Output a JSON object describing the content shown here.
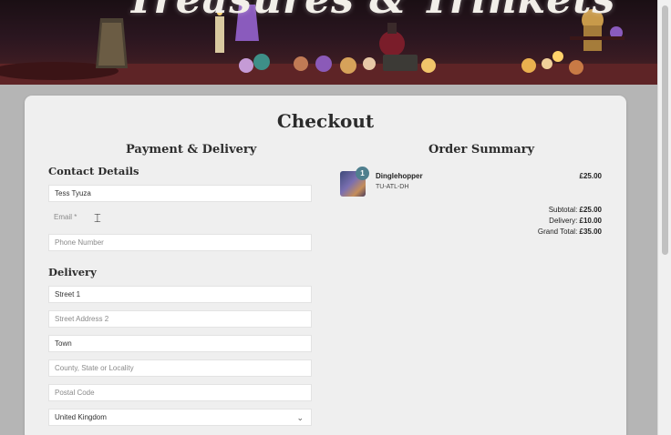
{
  "banner": {
    "title": "Treasures & Trinkets"
  },
  "page": {
    "title": "Checkout"
  },
  "payment": {
    "heading": "Payment & Delivery",
    "contact_heading": "Contact Details",
    "full_name_value": "Tess Tyuza",
    "email_placeholder": "Email *",
    "phone_placeholder": "Phone Number",
    "delivery_heading": "Delivery",
    "street1_value": "Street 1",
    "street2_placeholder": "Street Address 2",
    "town_value": "Town",
    "county_placeholder": "County, State or Locality",
    "postal_placeholder": "Postal Code",
    "country_value": "United Kingdom"
  },
  "order": {
    "heading": "Order Summary",
    "items": [
      {
        "quantity": "1",
        "name": "Dinglehopper",
        "sku": "TU-ATL-DH",
        "price": "£25.00"
      }
    ],
    "subtotal_label": "Subtotal:",
    "subtotal_value": "£25.00",
    "delivery_label": "Delivery:",
    "delivery_value": "£10.00",
    "grand_total_label": "Grand Total:",
    "grand_total_value": "£35.00"
  },
  "icons": {
    "dropdown": "chevron-down-icon",
    "cursor": "text-cursor-icon"
  }
}
